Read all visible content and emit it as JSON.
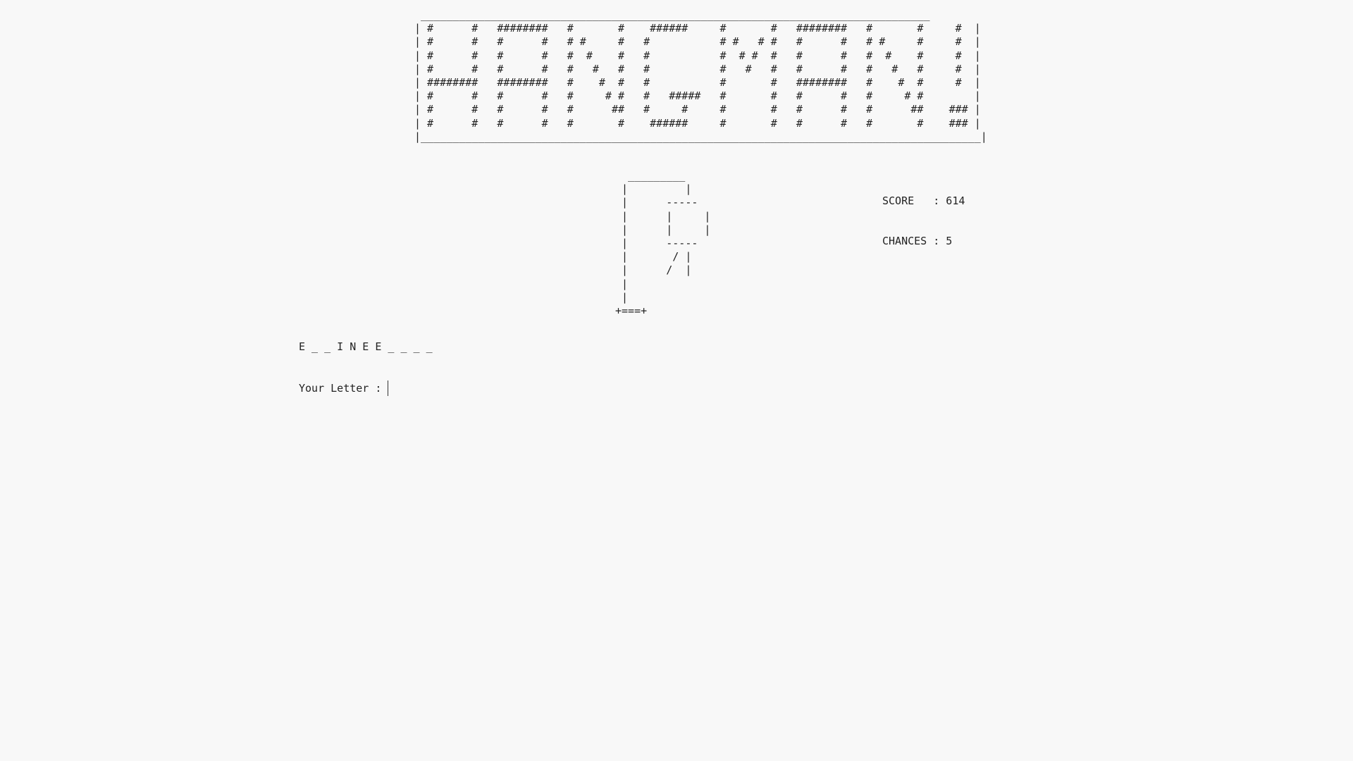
{
  "banner": {
    "ascii_art": " ________________________________________________________________________________\n| #      #   ########   #       #    ######     #       #   ########   #       #     #  |\n| #      #   #      #   # #     #   #           # #   # #   #      #   # #     #     #  |\n| #      #   #      #   #  #    #   #           #  # #  #   #      #   #  #    #     #  |\n| #      #   #      #   #   #   #   #           #   #   #   #      #   #   #   #     #  |\n| ########   ########   #    #  #   #           #       #   ########   #    #  #     #  |\n| #      #   #      #   #     # #   #   #####   #       #   #      #   #     # #        |\n| #      #   #      #   #      ##   #     #     #       #   #      #   #      ##    ### |\n| #      #   #      #   #       #    ######     #       #   #      #   #       #    ### |\n|________________________________________________________________________________________|"
  },
  "gallows": {
    "ascii_art": "  _________\n |         |\n |      -----\n |      |     |\n |      |     |\n |      -----\n |       / |\n |      /  |\n |\n |\n+===+"
  },
  "stats": {
    "score_text": "SCORE   : 614",
    "chances_text": "CHANCES : 5"
  },
  "word": {
    "display": "E _ _ I N E E _ _ _ _"
  },
  "input": {
    "label": "Your Letter :",
    "value": ""
  }
}
